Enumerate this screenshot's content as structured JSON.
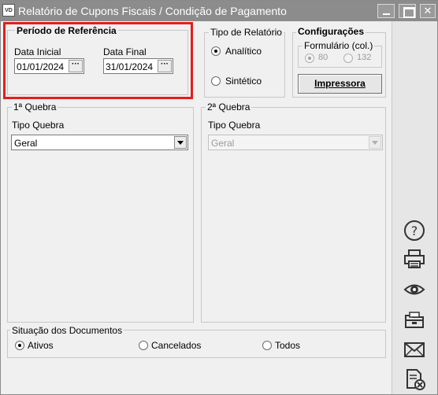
{
  "window": {
    "title": "Relatório de Cupons Fiscais / Condição de Pagamento",
    "app_badge": "VD"
  },
  "periodo": {
    "title": "Período de Referência",
    "data_inicial_label": "Data Inicial",
    "data_inicial_value": "01/01/2024",
    "data_final_label": "Data Final",
    "data_final_value": "31/01/2024",
    "picker_glyph": "···"
  },
  "tipo_relatorio": {
    "title": "Tipo de Relatório",
    "options": [
      "Analítico",
      "Sintético"
    ],
    "selected": "Analítico"
  },
  "configuracoes": {
    "title": "Configurações",
    "formulario_label": "Formulário (col.)",
    "options": [
      "80",
      "132"
    ],
    "selected": "80",
    "print_button": "Impressora"
  },
  "quebra1": {
    "title": "1ª Quebra",
    "tipo_label": "Tipo Quebra",
    "value": "Geral"
  },
  "quebra2": {
    "title": "2ª Quebra",
    "tipo_label": "Tipo Quebra",
    "value": "Geral"
  },
  "situacao": {
    "title": "Situação dos Documentos",
    "options": [
      "Ativos",
      "Cancelados",
      "Todos"
    ],
    "selected": "Ativos"
  },
  "sidebar_icons": [
    "help-icon",
    "printer-icon",
    "preview-eye-icon",
    "open-folder-icon",
    "email-icon",
    "export-file-icon"
  ]
}
